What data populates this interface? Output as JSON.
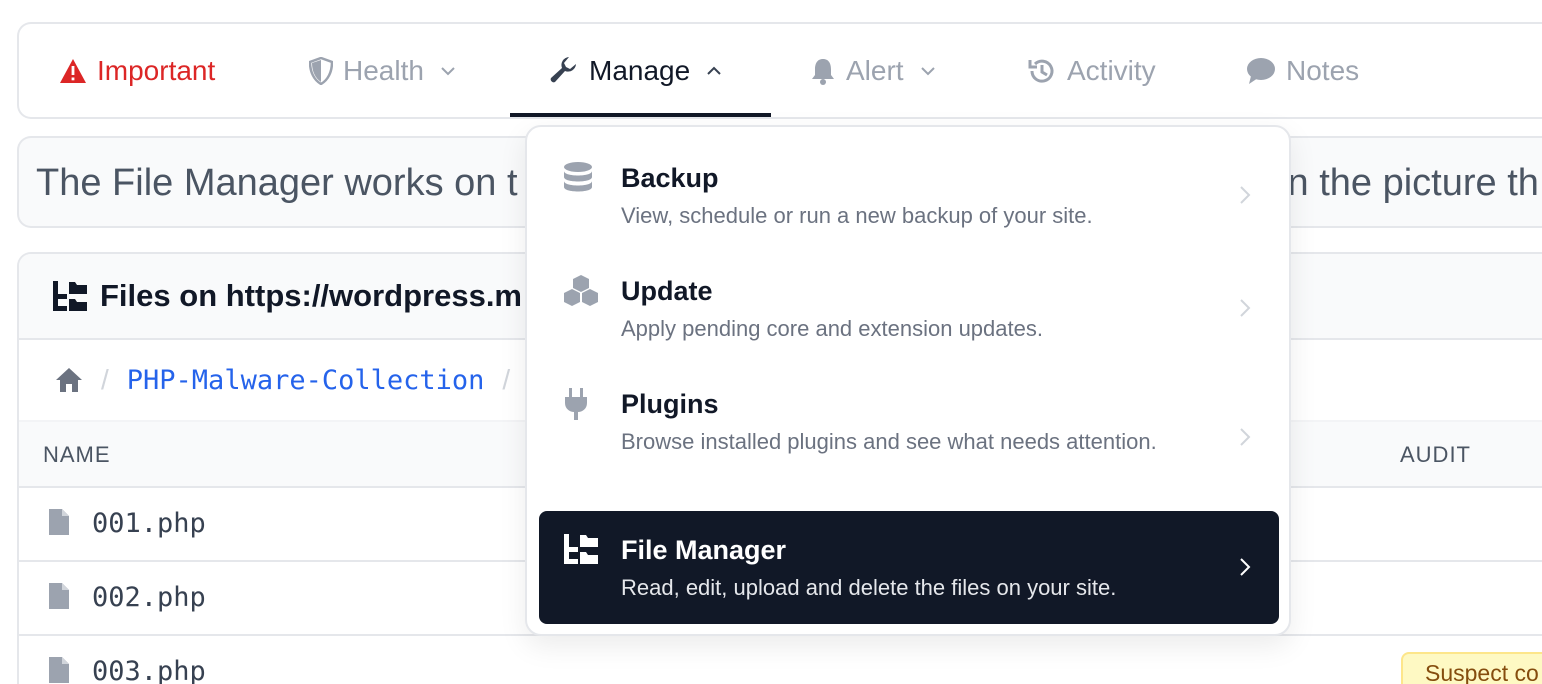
{
  "tabs": [
    {
      "label": "Important",
      "icon": "warning-triangle-icon"
    },
    {
      "label": "Health",
      "icon": "shield-icon"
    },
    {
      "label": "Manage",
      "icon": "wrench-icon"
    },
    {
      "label": "Alert",
      "icon": "bell-icon"
    },
    {
      "label": "Activity",
      "icon": "history-icon"
    },
    {
      "label": "Notes",
      "icon": "comment-icon"
    }
  ],
  "notice": {
    "text_left": "The File Manager works on t",
    "text_right": "n the picture th"
  },
  "files_panel": {
    "title": "Files on https://wordpress.m",
    "breadcrumb": {
      "folder": "PHP-Malware-Collection",
      "separator": "/"
    },
    "columns": {
      "name": "NAME",
      "audit": "AUDIT"
    },
    "rows": [
      {
        "name": "001.php",
        "audit": ""
      },
      {
        "name": "002.php",
        "audit": ""
      },
      {
        "name": "003.php",
        "audit": "Suspect co"
      }
    ]
  },
  "manage_menu": {
    "items": [
      {
        "title": "Backup",
        "description": "View, schedule or run a new backup of your site.",
        "icon": "database-icon",
        "selected": false
      },
      {
        "title": "Update",
        "description": "Apply pending core and extension updates.",
        "icon": "cubes-icon",
        "selected": false
      },
      {
        "title": "Plugins",
        "description": "Browse installed plugins and see what needs attention.",
        "icon": "plug-icon",
        "selected": false
      },
      {
        "title": "File Manager",
        "description": "Read, edit, upload and delete the files on your site.",
        "icon": "folder-tree-icon",
        "selected": true
      }
    ]
  },
  "colors": {
    "important": "#dc2626",
    "link": "#2563eb",
    "selected_bg": "#111827",
    "badge_bg": "#fef9c3"
  }
}
